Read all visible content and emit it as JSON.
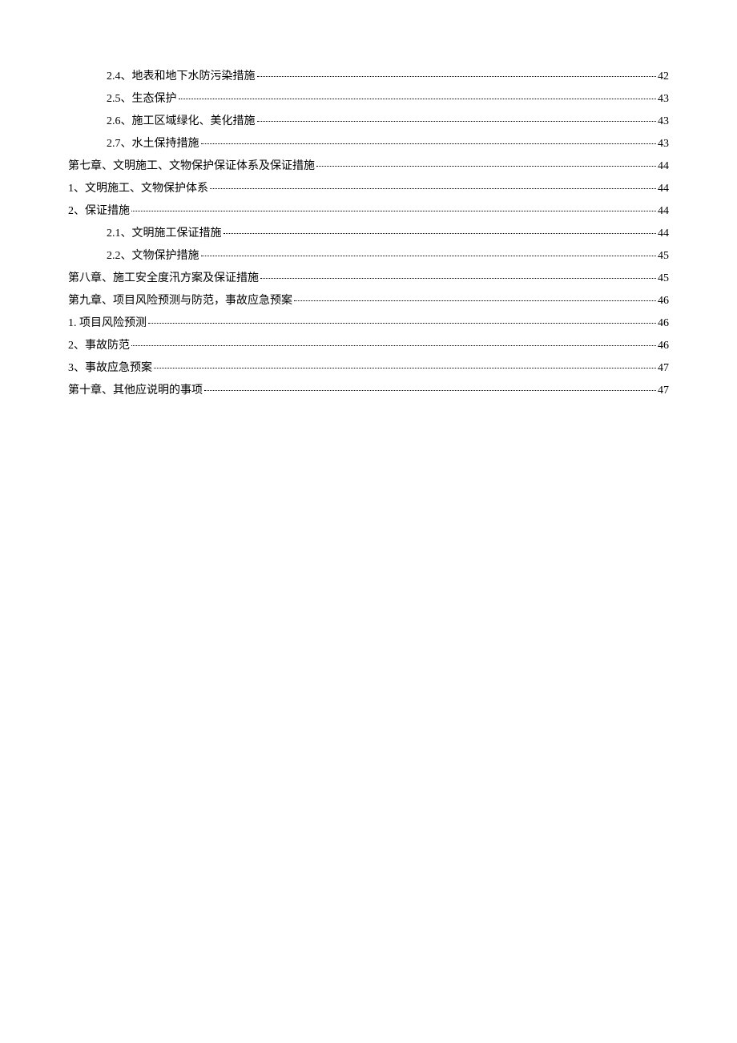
{
  "toc": [
    {
      "level": 1,
      "label": "2.4、地表和地下水防污染措施",
      "page": "42"
    },
    {
      "level": 1,
      "label": "2.5、生态保护",
      "page": "43"
    },
    {
      "level": 1,
      "label": "2.6、施工区域绿化、美化措施",
      "page": "43"
    },
    {
      "level": 1,
      "label": "2.7、水土保持措施",
      "page": "43"
    },
    {
      "level": 0,
      "label": "第七章、文明施工、文物保护保证体系及保证措施",
      "page": "44"
    },
    {
      "level": 0,
      "label": "1、文明施工、文物保护体系",
      "page": "44"
    },
    {
      "level": 0,
      "label": "2、保证措施",
      "page": "44"
    },
    {
      "level": 1,
      "label": "2.1、文明施工保证措施",
      "page": "44"
    },
    {
      "level": 1,
      "label": "2.2、文物保护措施",
      "page": "45"
    },
    {
      "level": 0,
      "label": "第八章、施工安全度汛方案及保证措施",
      "page": "45"
    },
    {
      "level": 0,
      "label": "第九章、项目风险预测与防范，事故应急预案",
      "page": "46"
    },
    {
      "level": 0,
      "label": "1. 项目风险预测",
      "page": "46"
    },
    {
      "level": 0,
      "label": "2、事故防范",
      "page": "46"
    },
    {
      "level": 0,
      "label": "3、事故应急预案",
      "page": "47"
    },
    {
      "level": 0,
      "label": "第十章、其他应说明的事项",
      "page": "47"
    }
  ]
}
